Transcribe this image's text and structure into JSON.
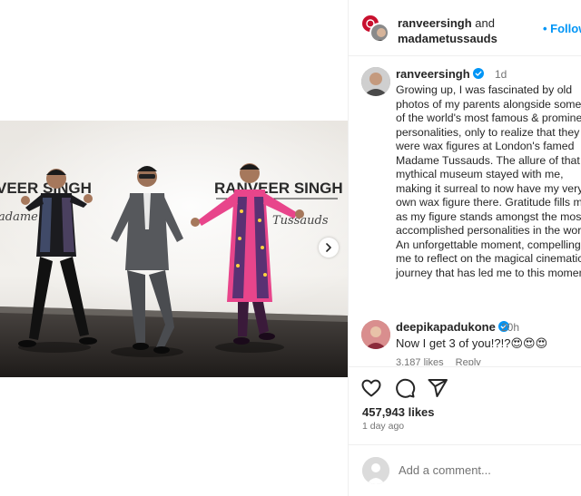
{
  "header": {
    "user1": "ranveersingh",
    "conjunction": "and",
    "user2": "madametussauds",
    "follow_label": "• Follow"
  },
  "caption": {
    "username": "ranveersingh",
    "time": "1d",
    "text": "Growing up, I was fascinated by old photos of my parents alongside some of the world's most famous & prominent personalities, only to realize that they were wax figures at London's famed Madame Tussauds. The allure of that mythical museum stayed with me, making it surreal to now have my very own wax figure there. Gratitude fills me as my figure stands amongst the most accomplished personalities in the world. An unforgettable moment, compelling me to reflect on the magical cinematic journey that has led me to this moment."
  },
  "comment": {
    "username": "deepikapadukone",
    "time": "20h",
    "text": "Now I get 3 of you!?!?😍😍😍",
    "likes": "3,187 likes",
    "reply": "Reply"
  },
  "photo": {
    "sign_left": "VEER SINGH",
    "sign_right": "RANVEER SINGH",
    "script_left": "adame",
    "script_right": "Tussauds"
  },
  "actions": {
    "like_icon": "heart-icon",
    "comment_icon": "comment-bubble-icon",
    "share_icon": "paper-plane-icon",
    "likes": "457,943 likes",
    "ago": "1 day ago"
  },
  "add_comment": {
    "placeholder": "Add a comment..."
  },
  "colors": {
    "accent": "#0095f6",
    "text": "#262626",
    "muted": "#737373",
    "verified": "#0095f6",
    "jacket_pink": "#e8458b"
  }
}
